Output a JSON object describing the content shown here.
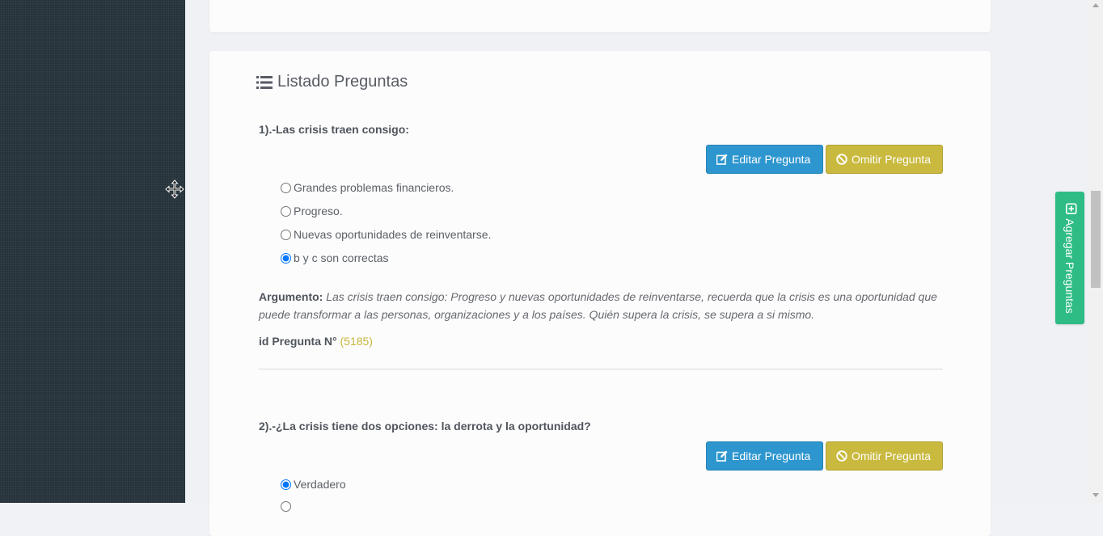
{
  "section": {
    "title": "Listado Preguntas",
    "icon": "list-icon"
  },
  "buttons": {
    "edit_label": "Editar Pregunta",
    "omit_label": "Omitir Pregunta"
  },
  "questions": [
    {
      "text": "1).-Las crisis traen consigo:",
      "options": [
        {
          "label": "Grandes problemas financieros.",
          "selected": false
        },
        {
          "label": "Progreso.",
          "selected": false
        },
        {
          "label": "Nuevas oportunidades de reinventarse.",
          "selected": false
        },
        {
          "label": "b y c son correctas",
          "selected": true
        }
      ],
      "argument_label": "Argumento:",
      "argument_text": "Las crisis traen consigo: Progreso y nuevas oportunidades de reinventarse, recuerda que la crisis es una oportunidad que puede transformar a las personas, organizaciones y a los países. Quién supera la crisis, se supera a si mismo.",
      "id_label": "id Pregunta N°",
      "id_value": "(5185)"
    },
    {
      "text": "2).-¿La crisis tiene dos opciones: la derrota y la oportunidad?",
      "options": [
        {
          "label": "Verdadero",
          "selected": true
        }
      ]
    }
  ],
  "sidebar_button": {
    "label": "Agregar Preguntas",
    "icon": "plus-square-icon"
  },
  "colors": {
    "edit": "#2e96cf",
    "omit": "#c9b93e",
    "add": "#2ebc84",
    "id_value": "#c7b53a"
  }
}
